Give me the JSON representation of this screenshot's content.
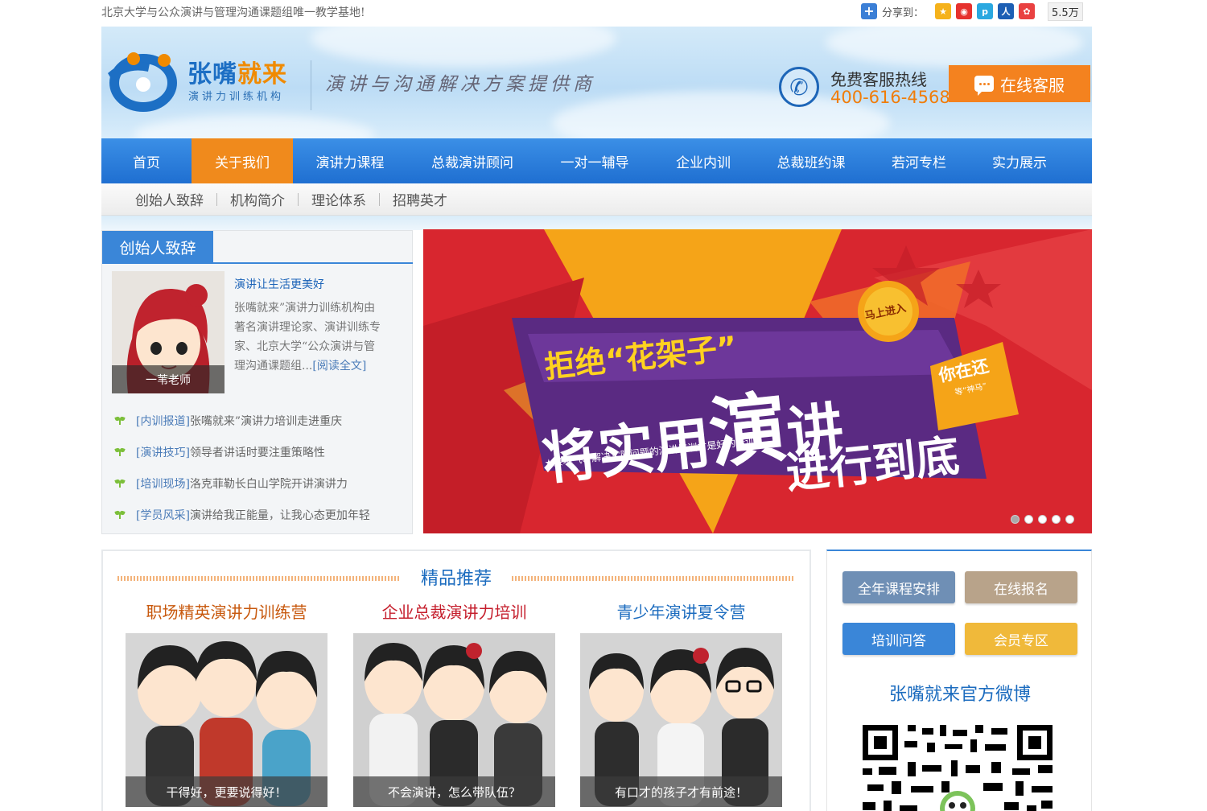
{
  "topbar": {
    "tagline": "北京大学与公众演讲与管理沟通课题组唯一教学基地!",
    "share_label": "分享到：",
    "share_count": "5.5万"
  },
  "header": {
    "logo_name_main": "张嘴",
    "logo_name_highlight": "就来",
    "logo_sub": "演讲力训练机构",
    "slogan": "演讲与沟通解决方案提供商",
    "hotline_label": "免费客服热线",
    "hotline_number": "400-616-4568",
    "online_service_label": "在线客服"
  },
  "nav": {
    "items": [
      {
        "label": "首页"
      },
      {
        "label": "关于我们"
      },
      {
        "label": "演讲力课程"
      },
      {
        "label": "总裁演讲顾问"
      },
      {
        "label": "一对一辅导"
      },
      {
        "label": "企业内训"
      },
      {
        "label": "总裁班约课"
      },
      {
        "label": "若河专栏"
      },
      {
        "label": "实力展示"
      }
    ],
    "active_index": 1
  },
  "subnav": {
    "items": [
      {
        "label": "创始人致辞"
      },
      {
        "label": "机构简介"
      },
      {
        "label": "理论体系"
      },
      {
        "label": "招聘英才"
      }
    ]
  },
  "founder": {
    "title": "创始人致辞",
    "photo_caption": "一苇老师",
    "headline": "演讲让生活更美好",
    "body_lines": [
      "张嘴就来”演讲力训练机构由",
      "著名演讲理论家、演讲训练专",
      "家、北京大学“公众演讲与管",
      "理沟通课题组..."
    ],
    "read_more": "[阅读全文]",
    "news": [
      {
        "tag": "[内训报道]",
        "text": "张嘴就来”演讲力培训走进重庆"
      },
      {
        "tag": "[演讲技巧]",
        "text": "领导者讲话时要注重策略性"
      },
      {
        "tag": "[培训现场]",
        "text": "洛克菲勒长白山学院开讲演讲力"
      },
      {
        "tag": "[学员风采]",
        "text": "演讲给我正能量，让我心态更加年轻"
      }
    ]
  },
  "banner": {
    "badge": "马上进入",
    "line1": "拒绝“花架子”",
    "big_char": "演",
    "line2_prefix": "将实用",
    "line2_suffix": "讲",
    "line3": "进行到底",
    "side_text": "你在还",
    "side_sub": "等“神马”",
    "tagline": "★接地气、解决实际问题的演讲培训才是好的培训",
    "slide_count": 5,
    "active_slide": 0,
    "colors": {
      "red": "#d8262f",
      "orange": "#f5a418",
      "purple": "#5a2a82",
      "yellow": "#ffd21f"
    }
  },
  "recommend": {
    "title": "精品推荐",
    "courses": [
      {
        "name": "职场精英演讲力训练营",
        "caption": "干得好，更要说得好！",
        "color": "#c8590e"
      },
      {
        "name": "企业总裁演讲力培训",
        "caption": "不会演讲，怎么带队伍？",
        "color": "#c51e2c"
      },
      {
        "name": "青少年演讲夏令营",
        "caption": "有口才的孩子才有前途！",
        "color": "#1c6cbf"
      }
    ]
  },
  "side": {
    "buttons": [
      {
        "label": "全年课程安排",
        "color": "#6f8fb5"
      },
      {
        "label": "在线报名",
        "color": "#b8a38a"
      },
      {
        "label": "培训问答",
        "color": "#3a86d8"
      },
      {
        "label": "会员专区",
        "color": "#f0b93a"
      }
    ],
    "weibo_title": "张嘴就来官方微博"
  }
}
